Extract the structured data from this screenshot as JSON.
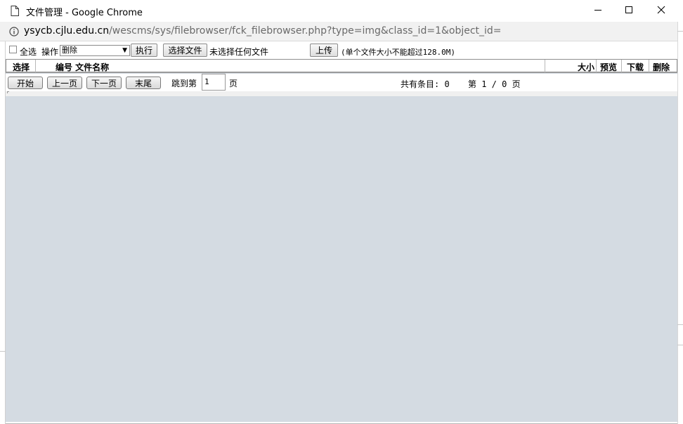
{
  "window": {
    "title": "文件管理 - Google Chrome"
  },
  "address": {
    "host": "ysycb.cjlu.edu.cn",
    "path": "/wescms/sys/filebrowser/fck_filebrowser.php?type=img&class_id=1&object_id="
  },
  "toolbar": {
    "select_all_label": "全选",
    "operation_label": "操作",
    "operation_selected": "删除",
    "execute_label": "执行",
    "choose_file_label": "选择文件",
    "no_file_label": "未选择任何文件",
    "upload_label": "上传",
    "size_limit_note": "(单个文件大小不能超过128.0M)"
  },
  "table": {
    "columns": {
      "select": "选择",
      "number_name": "编号 文件名称",
      "size": "大小",
      "preview": "预览",
      "download": "下载",
      "delete": "删除"
    }
  },
  "pager": {
    "first_label": "开始",
    "prev_label": "上一页",
    "next_label": "下一页",
    "last_label": "末尾",
    "jump_label": "跳到第",
    "page_value": "1",
    "page_unit": "页",
    "total_items": "共有条目: 0",
    "page_status": "第 1 / 0 页"
  },
  "colors": {
    "content_background": "#d4dbe2",
    "address_bar": "#f1f1f1"
  },
  "icons": {
    "title": "page-icon",
    "info": "info-icon",
    "minimize": "minimize-icon",
    "maximize": "maximize-icon",
    "close": "close-icon"
  }
}
